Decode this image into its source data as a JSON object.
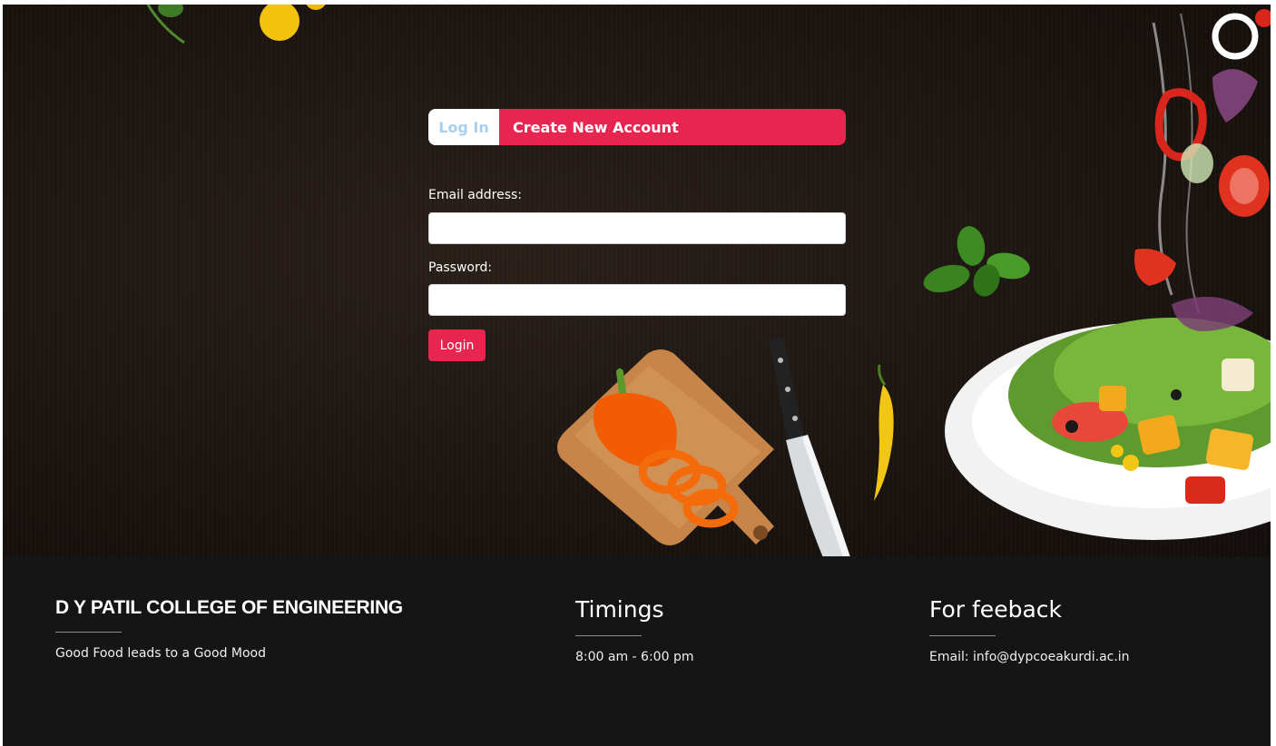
{
  "tabs": {
    "login_label": "Log In",
    "create_label": "Create New Account"
  },
  "form": {
    "email_label": "Email address:",
    "email_value": "",
    "password_label": "Password:",
    "password_value": "",
    "login_button": "Login"
  },
  "footer": {
    "college": {
      "title": "D Y PATIL COLLEGE OF ENGINEERING",
      "tagline": "Good Food leads to a Good Mood"
    },
    "timings": {
      "title": "Timings",
      "hours": "8:00 am - 6:00 pm"
    },
    "feedback": {
      "title": "For feeback",
      "email": "Email: info@dypcoeakurdi.ac.in"
    }
  },
  "colors": {
    "accent": "#e8254f",
    "login_tab_text": "#a9cfee",
    "footer_bg": "#151515",
    "hero_bg": "#1c1511"
  },
  "icons": [
    "basil-leaves-icon",
    "knife-icon",
    "bell-pepper-icon",
    "chili-icon",
    "salad-plate-icon",
    "tomato-icon"
  ]
}
